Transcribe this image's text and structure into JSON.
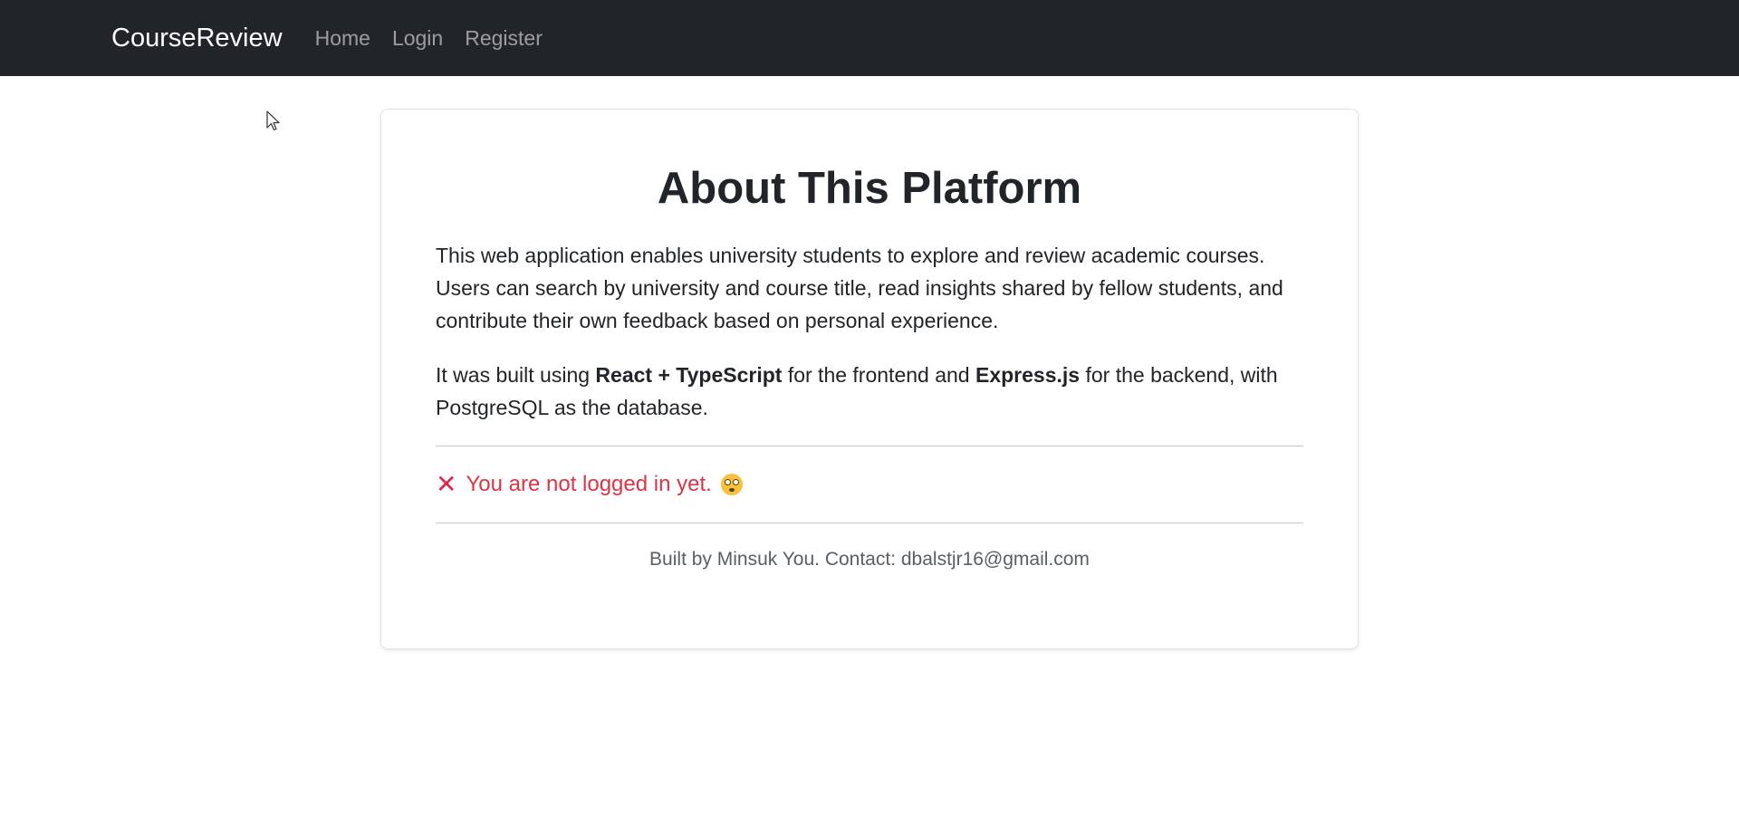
{
  "navbar": {
    "brand": "CourseReview",
    "links": [
      {
        "label": "Home"
      },
      {
        "label": "Login"
      },
      {
        "label": "Register"
      }
    ],
    "background": "#212529"
  },
  "about": {
    "title": "About This Platform",
    "paragraph1": "This web application enables university students to explore and review academic courses. Users can search by university and course title, read insights shared by fellow students, and contribute their own feedback based on personal experience.",
    "paragraph2": {
      "part1": "It was built using ",
      "bold1": "React + TypeScript",
      "part2": " for the frontend and ",
      "bold2": "Express.js",
      "part3": " for the backend, with PostgreSQL as the database."
    },
    "status": {
      "icon": "x-icon",
      "text": "You are not logged in yet.",
      "emoji": "flushed-face-icon",
      "color": "#dc3545"
    },
    "footer": "Built by Minsuk You. Contact: dbalstjr16@gmail.com"
  }
}
